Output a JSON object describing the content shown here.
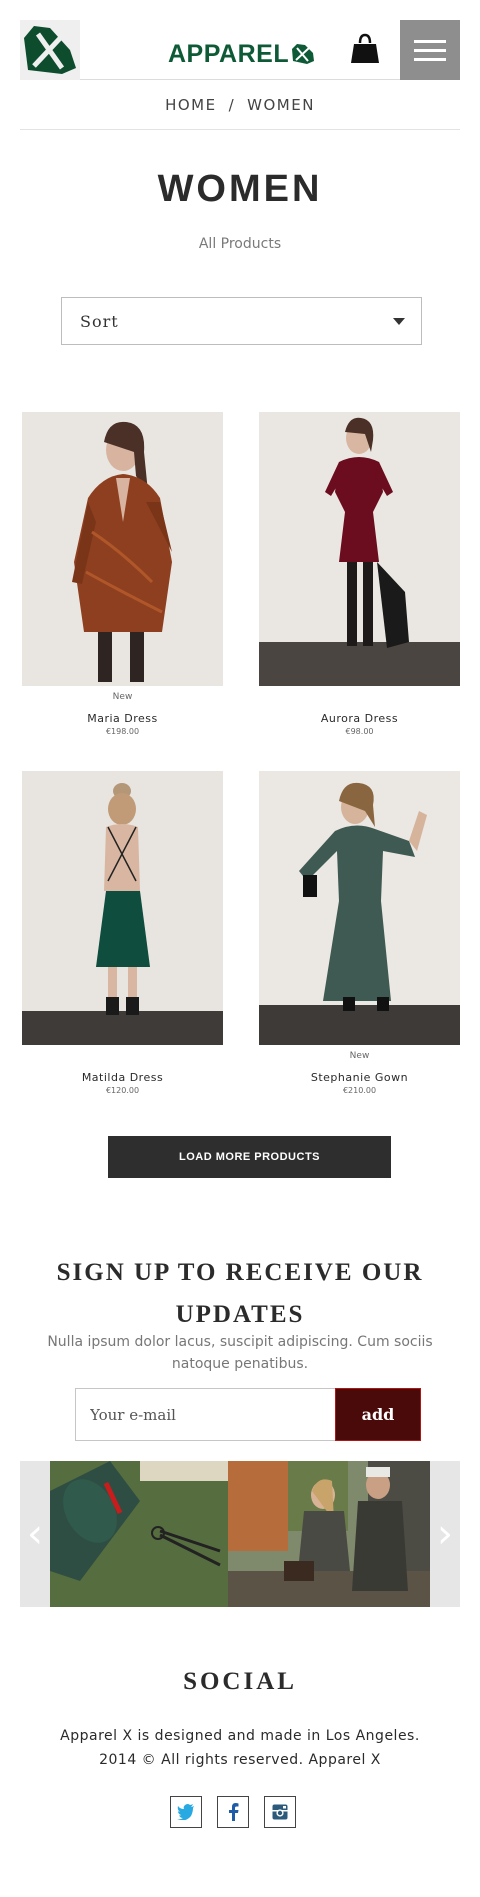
{
  "header": {
    "brand": "APPAREL",
    "logo_icon": "apparel-x-logo-icon",
    "bag_icon": "shopping-bag-icon",
    "menu_icon": "hamburger-menu-icon",
    "brand_color": "#0f5a36"
  },
  "breadcrumb": {
    "home": "HOME",
    "separator": "/",
    "current": "WOMEN"
  },
  "page": {
    "title": "WOMEN",
    "subtitle": "All Products"
  },
  "sort": {
    "label": "Sort"
  },
  "products": [
    {
      "tag": "New",
      "name": "Maria Dress",
      "price": "€198.00"
    },
    {
      "tag": "",
      "name": "Aurora Dress",
      "price": "€98.00"
    },
    {
      "tag": "",
      "name": "Matilda Dress",
      "price": "€120.00"
    },
    {
      "tag": "New",
      "name": "Stephanie Gown",
      "price": "€210.00"
    }
  ],
  "load_more": "LOAD MORE PRODUCTS",
  "signup": {
    "title": "SIGN UP TO RECEIVE OUR UPDATES",
    "text": "Nulla ipsum dolor lacus, suscipit adipiscing. Cum sociis natoque penatibus.",
    "placeholder": "Your e-mail",
    "button": "add",
    "button_color": "#4b0a0a"
  },
  "carousel": {
    "prev": "‹",
    "next": "›"
  },
  "social": {
    "title": "SOCIAL",
    "line1": "Apparel X is designed and made in Los Angeles.",
    "line2": "2014 © All rights reserved. Apparel X",
    "icons": [
      "twitter-icon",
      "facebook-icon",
      "instagram-icon"
    ]
  }
}
